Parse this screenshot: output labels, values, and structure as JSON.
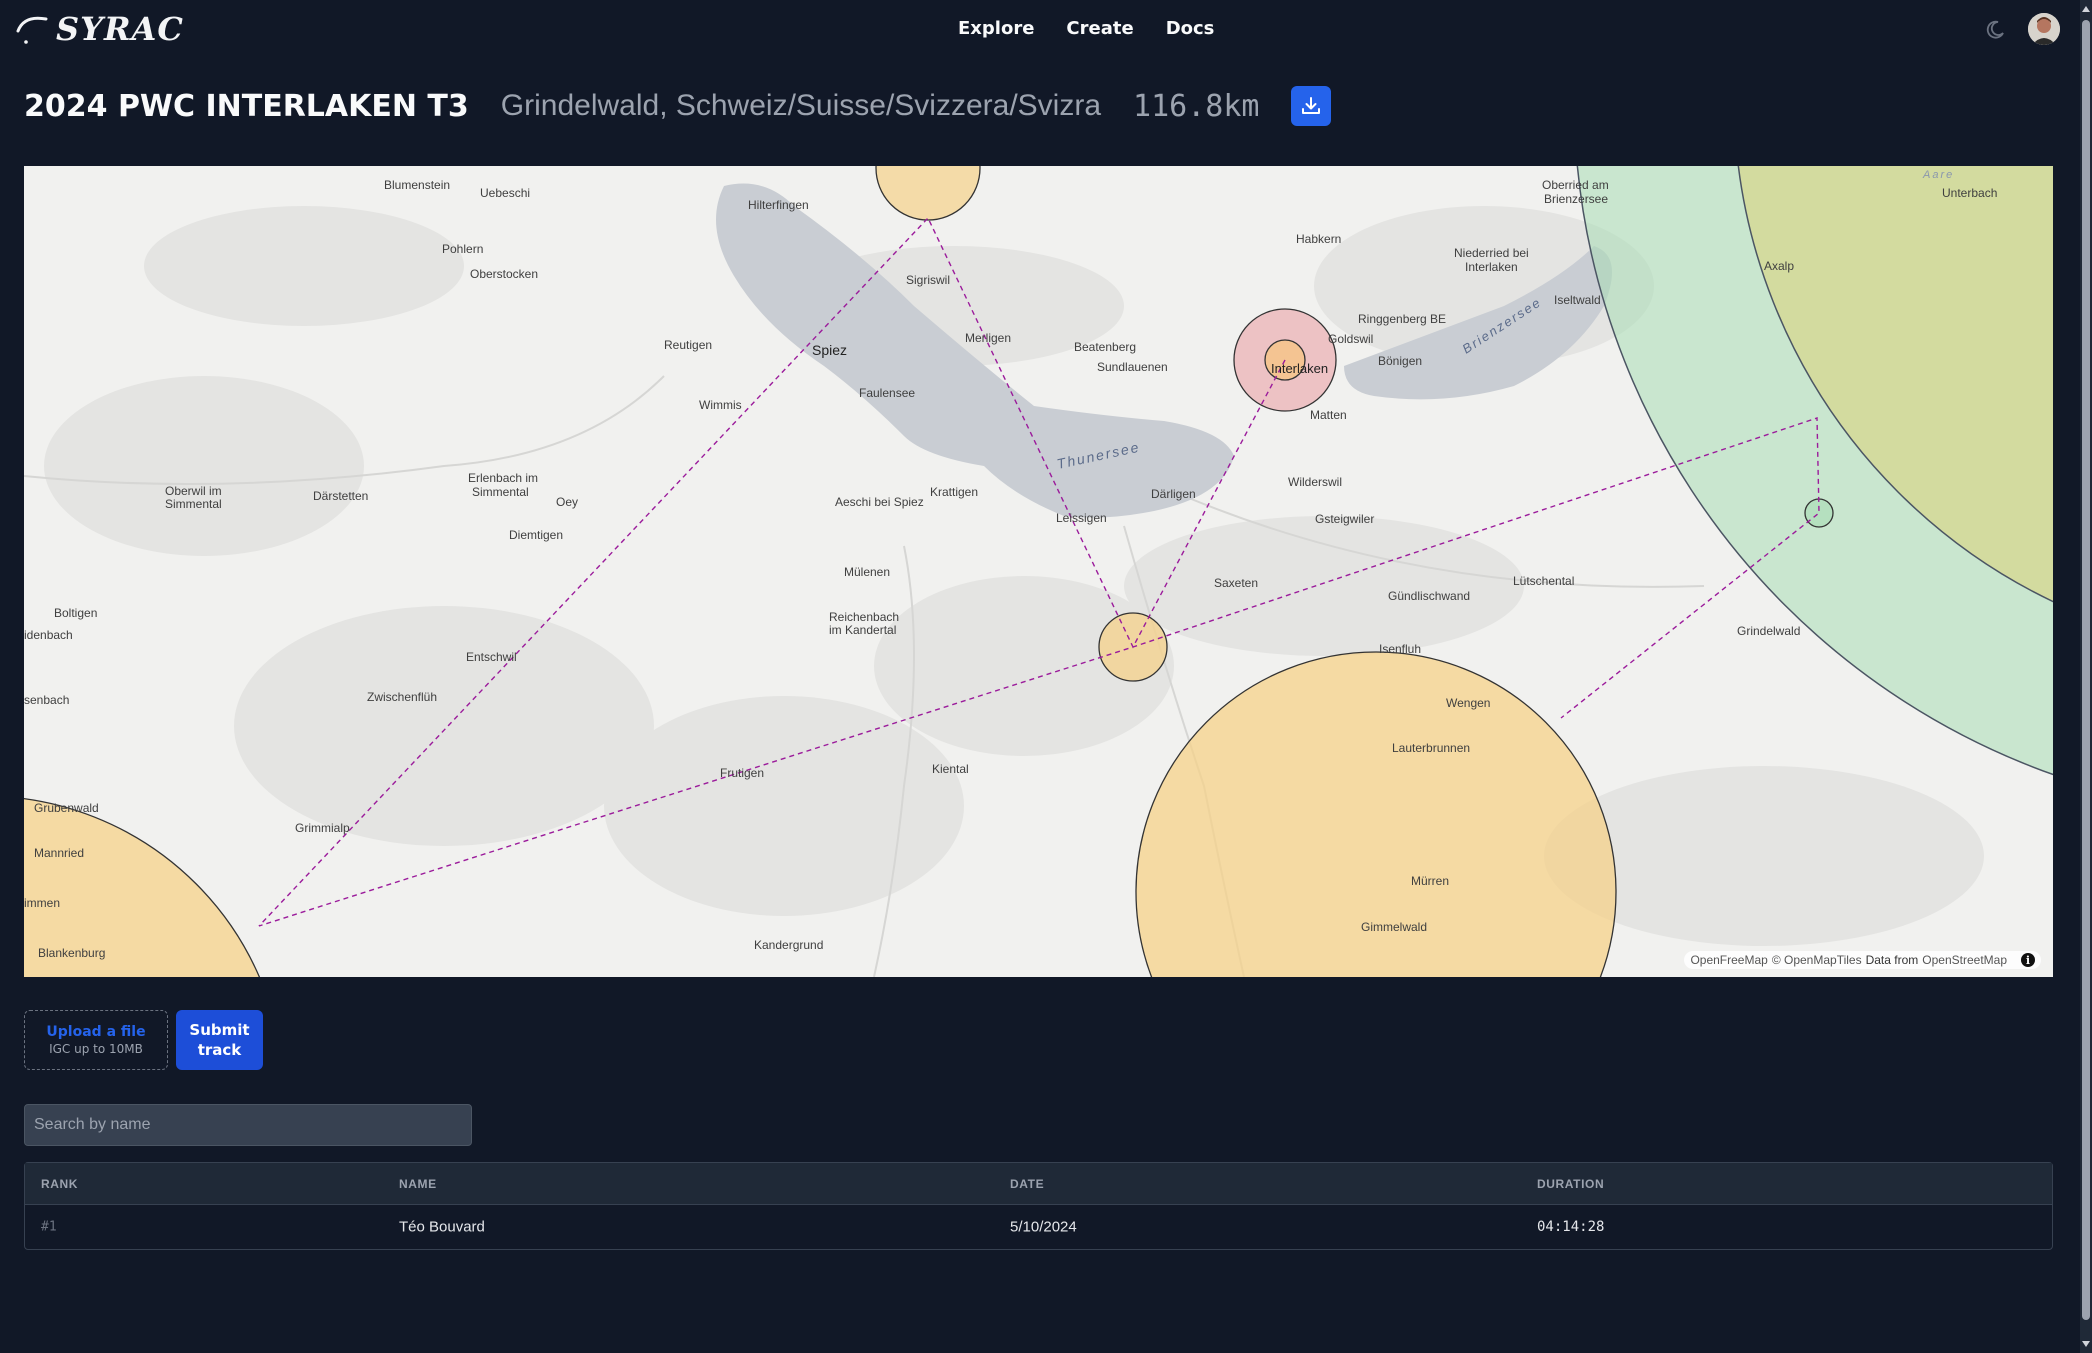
{
  "app": {
    "name": "SYRAC"
  },
  "nav": {
    "links": [
      "Explore",
      "Create",
      "Docs"
    ]
  },
  "task": {
    "title": "2024 PWC INTERLAKEN T3",
    "location": "Grindelwald, Schweiz/Suisse/Svizzera/Svizra",
    "distance": "116.8km"
  },
  "map": {
    "places": [
      "Blumenstein",
      "Uebeschi",
      "Hilterfingen",
      "Oberried am",
      "Brienzersee",
      "Unterbach",
      "Pohlern",
      "Oberstocken",
      "Habkern",
      "Niederried bei",
      "Interlaken",
      "Axalp",
      "Sigriswil",
      "Iseltwald",
      "Ringgenberg BE",
      "Reutigen",
      "Spiez",
      "Merligen",
      "Beatenberg",
      "Goldswil",
      "Sundlauenen",
      "Interlaken",
      "Bönigen",
      "Wimmis",
      "Faulensee",
      "Matten",
      "Oberwil im",
      "Simmental",
      "Därstetten",
      "Erlenbach im",
      "Simmental",
      "Oey",
      "Krattigen",
      "Aeschi bei Spiez",
      "Leissigen",
      "Därligen",
      "Wilderswil",
      "Gsteigwiler",
      "Diemtigen",
      "Mülenen",
      "Saxeten",
      "Lütschental",
      "Gündlischwand",
      "Boltigen",
      "Reichenbach",
      "im Kandertal",
      "Grindelwald",
      "idenbach",
      "Entschwil",
      "Isenfluh",
      "senbach",
      "Zwischenflüh",
      "Wengen",
      "Frutigen",
      "Lauterbrunnen",
      "Kiental",
      "Grubenwald",
      "Grimmialp",
      "Mannried",
      "Mürren",
      "immen",
      "Gimmelwald",
      "Blankenburg",
      "Kandergrund"
    ],
    "water": [
      "Thunersee",
      "Brienzersee",
      "Aare"
    ],
    "attribution": {
      "provider": "OpenFreeMap",
      "copyright": "© OpenMapTiles",
      "data_from": "Data from",
      "source": "OpenStreetMap"
    },
    "colors": {
      "turnpoint": "#f5d28a",
      "start": "#e99aa0",
      "goal": "#a8dcb4",
      "route": "#9b1b9b",
      "lake": "#c9cdd3"
    }
  },
  "upload": {
    "link": "Upload a file",
    "hint": "IGC up to 10MB",
    "submit": "Submit track"
  },
  "search": {
    "placeholder": "Search by name",
    "value": ""
  },
  "table": {
    "headers": {
      "rank": "RANK",
      "name": "NAME",
      "date": "DATE",
      "duration": "DURATION"
    },
    "rows": [
      {
        "rank": "#1",
        "name": "Téo Bouvard",
        "date": "5/10/2024",
        "duration": "04:14:28"
      }
    ]
  },
  "colors": {
    "background": "#111827",
    "accent": "#2563eb"
  }
}
